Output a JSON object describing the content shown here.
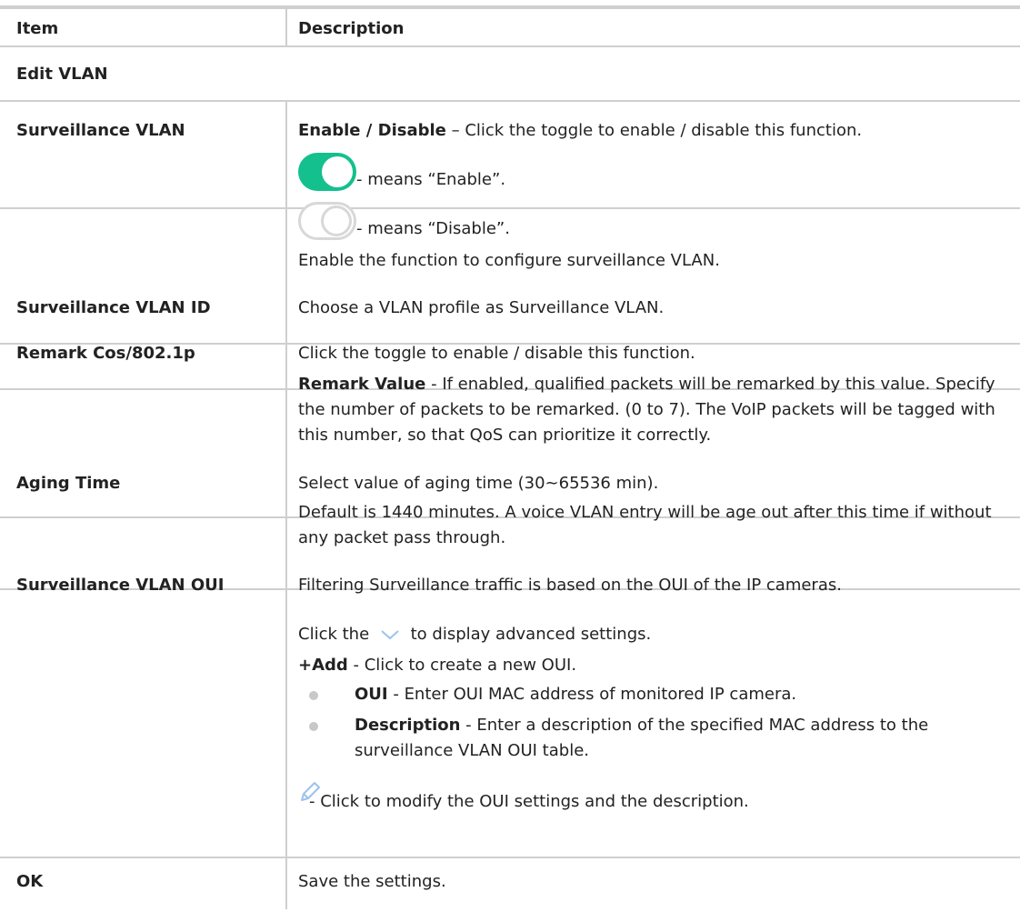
{
  "header": {
    "item": "Item",
    "description": "Description"
  },
  "section_title": "Edit VLAN",
  "rows": {
    "surveillance_vlan": {
      "item": "Surveillance VLAN",
      "line1_bold": "Enable / Disable",
      "line1_rest": " – Click the toggle to enable / disable this function.",
      "enable_text": "- means “Enable”.",
      "disable_text": "- means “Disable”.",
      "line4": "Enable the function to configure surveillance VLAN."
    },
    "surveillance_vlan_id": {
      "item": "Surveillance VLAN ID",
      "desc": "Choose a VLAN profile as Surveillance VLAN."
    },
    "remark_cos": {
      "item": "Remark Cos/802.1p",
      "line1": "Click the toggle to enable / disable this function.",
      "line2_bold": "Remark Value",
      "line2_rest": " - If enabled, qualified packets will be remarked by this value. Specify the number of packets to be remarked. (0 to 7). The VoIP packets will be tagged with this number, so that QoS can prioritize it correctly."
    },
    "aging_time": {
      "item": "Aging Time",
      "line1": "Select value of aging time (30~65536 min).",
      "line2": "Default is 1440 minutes. A voice VLAN entry will be age out after this time if without any packet pass through."
    },
    "surveillance_vlan_oui": {
      "item": "Surveillance VLAN OUI",
      "line1": "Filtering Surveillance traffic is based on the OUI of the IP cameras.",
      "click_the": "Click the",
      "click_rest": "to display advanced settings.",
      "add_bold": "+Add",
      "add_rest": " - Click to create a new OUI.",
      "bullet1_bold": "OUI",
      "bullet1_rest": " - Enter OUI MAC address of monitored IP camera.",
      "bullet2_bold": "Description",
      "bullet2_rest": " - Enter a description of the specified MAC address to the surveillance VLAN OUI table.",
      "pencil_text": "- Click to modify the OUI settings and the description."
    },
    "ok": {
      "item": "OK",
      "desc": "Save the settings."
    }
  },
  "icons": {
    "toggle_on": "toggle-on-icon",
    "toggle_off": "toggle-off-icon",
    "chevron": "chevron-down-icon",
    "pencil": "pencil-icon"
  },
  "colors": {
    "toggle_on": "#13c08e",
    "grid": "#cfcfcf",
    "icon_blue": "#9cc3ea"
  }
}
